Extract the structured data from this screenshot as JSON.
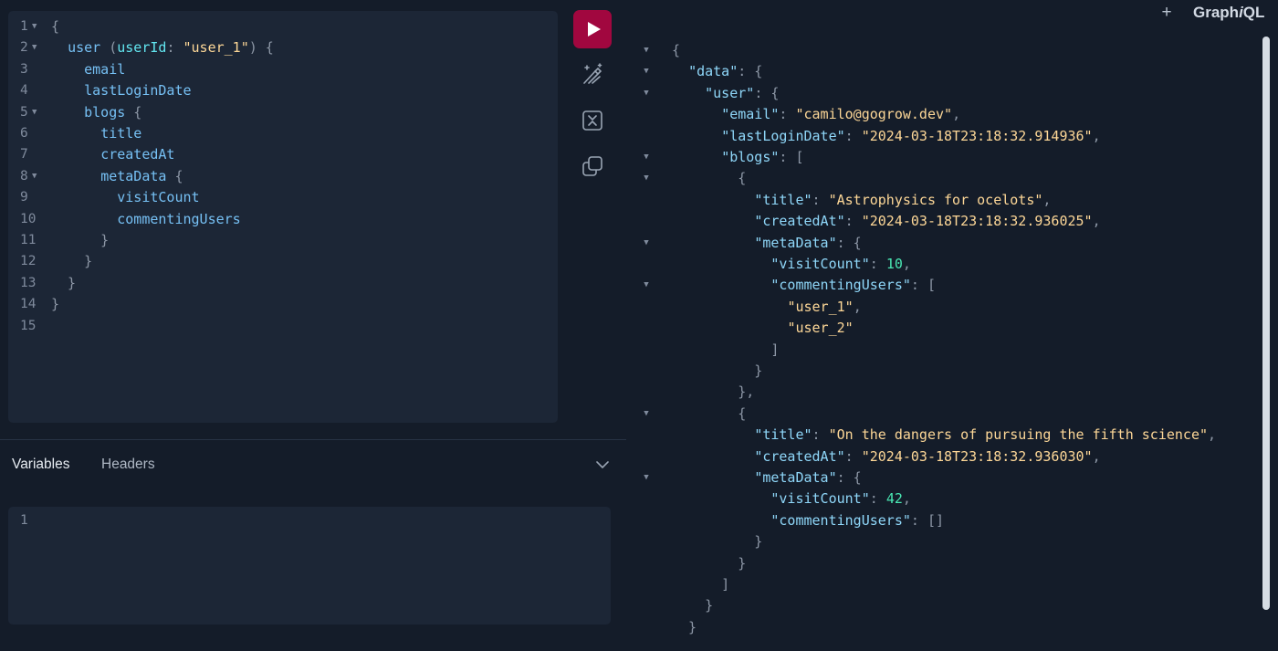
{
  "app": {
    "add_tab_label": "+",
    "brand_prefix": "Graph",
    "brand_i": "i",
    "brand_suffix": "QL"
  },
  "colors": {
    "background": "#141c29",
    "editor_background": "#1c2636",
    "run_button": "#a1073f",
    "field": "#76c0f4",
    "argument": "#62e5ef",
    "string": "#fdd797",
    "number": "#49e6b2",
    "punctuation": "#8d97a6"
  },
  "toolbar": {
    "run_icon": "play-icon",
    "prettify_icon": "magic-wand-icon",
    "merge_fragments_icon": "merge-icon",
    "copy_icon": "copy-icon"
  },
  "query_editor": {
    "folded_lines": [
      1,
      2,
      5,
      8
    ],
    "lines": [
      {
        "number": "1",
        "tokens": [
          {
            "t": "{",
            "c": "punct"
          }
        ]
      },
      {
        "number": "2",
        "tokens": [
          {
            "t": "  ",
            "c": "punct"
          },
          {
            "t": "user",
            "c": "field"
          },
          {
            "t": " (",
            "c": "punct"
          },
          {
            "t": "userId",
            "c": "arg"
          },
          {
            "t": ": ",
            "c": "punct"
          },
          {
            "t": "\"user_1\"",
            "c": "str"
          },
          {
            "t": ") {",
            "c": "punct"
          }
        ]
      },
      {
        "number": "3",
        "tokens": [
          {
            "t": "    ",
            "c": "punct"
          },
          {
            "t": "email",
            "c": "field"
          }
        ]
      },
      {
        "number": "4",
        "tokens": [
          {
            "t": "    ",
            "c": "punct"
          },
          {
            "t": "lastLoginDate",
            "c": "field"
          }
        ]
      },
      {
        "number": "5",
        "tokens": [
          {
            "t": "    ",
            "c": "punct"
          },
          {
            "t": "blogs",
            "c": "field"
          },
          {
            "t": " {",
            "c": "punct"
          }
        ]
      },
      {
        "number": "6",
        "tokens": [
          {
            "t": "      ",
            "c": "punct"
          },
          {
            "t": "title",
            "c": "field"
          }
        ]
      },
      {
        "number": "7",
        "tokens": [
          {
            "t": "      ",
            "c": "punct"
          },
          {
            "t": "createdAt",
            "c": "field"
          }
        ]
      },
      {
        "number": "8",
        "tokens": [
          {
            "t": "      ",
            "c": "punct"
          },
          {
            "t": "metaData",
            "c": "field"
          },
          {
            "t": " {",
            "c": "punct"
          }
        ]
      },
      {
        "number": "9",
        "tokens": [
          {
            "t": "        ",
            "c": "punct"
          },
          {
            "t": "visitCount",
            "c": "field"
          }
        ]
      },
      {
        "number": "10",
        "tokens": [
          {
            "t": "        ",
            "c": "punct"
          },
          {
            "t": "commentingUsers",
            "c": "field"
          }
        ]
      },
      {
        "number": "11",
        "tokens": [
          {
            "t": "      }",
            "c": "punct"
          }
        ]
      },
      {
        "number": "12",
        "tokens": [
          {
            "t": "    }",
            "c": "punct"
          }
        ]
      },
      {
        "number": "13",
        "tokens": [
          {
            "t": "  }",
            "c": "punct"
          }
        ]
      },
      {
        "number": "14",
        "tokens": [
          {
            "t": "}",
            "c": "punct"
          }
        ]
      },
      {
        "number": "15",
        "tokens": []
      }
    ]
  },
  "bottom_panel": {
    "tabs": [
      {
        "label": "Variables",
        "active": true
      },
      {
        "label": "Headers",
        "active": false
      }
    ],
    "toggle_icon": "chevron-down-icon",
    "variables_line_number": "1"
  },
  "result": {
    "fold_markers": [
      1,
      2,
      3,
      6,
      7,
      10,
      12,
      18,
      21
    ],
    "lines": [
      {
        "tokens": [
          {
            "t": "{",
            "c": "punct"
          }
        ]
      },
      {
        "tokens": [
          {
            "t": "  ",
            "c": "punct"
          },
          {
            "t": "\"data\"",
            "c": "key"
          },
          {
            "t": ": {",
            "c": "punct"
          }
        ]
      },
      {
        "tokens": [
          {
            "t": "    ",
            "c": "punct"
          },
          {
            "t": "\"user\"",
            "c": "key"
          },
          {
            "t": ": {",
            "c": "punct"
          }
        ]
      },
      {
        "tokens": [
          {
            "t": "      ",
            "c": "punct"
          },
          {
            "t": "\"email\"",
            "c": "key"
          },
          {
            "t": ": ",
            "c": "punct"
          },
          {
            "t": "\"camilo@gogrow.dev\"",
            "c": "str"
          },
          {
            "t": ",",
            "c": "punct"
          }
        ]
      },
      {
        "tokens": [
          {
            "t": "      ",
            "c": "punct"
          },
          {
            "t": "\"lastLoginDate\"",
            "c": "key"
          },
          {
            "t": ": ",
            "c": "punct"
          },
          {
            "t": "\"2024-03-18T23:18:32.914936\"",
            "c": "str"
          },
          {
            "t": ",",
            "c": "punct"
          }
        ]
      },
      {
        "tokens": [
          {
            "t": "      ",
            "c": "punct"
          },
          {
            "t": "\"blogs\"",
            "c": "key"
          },
          {
            "t": ": [",
            "c": "punct"
          }
        ]
      },
      {
        "tokens": [
          {
            "t": "        {",
            "c": "punct"
          }
        ]
      },
      {
        "tokens": [
          {
            "t": "          ",
            "c": "punct"
          },
          {
            "t": "\"title\"",
            "c": "key"
          },
          {
            "t": ": ",
            "c": "punct"
          },
          {
            "t": "\"Astrophysics for ocelots\"",
            "c": "str"
          },
          {
            "t": ",",
            "c": "punct"
          }
        ]
      },
      {
        "tokens": [
          {
            "t": "          ",
            "c": "punct"
          },
          {
            "t": "\"createdAt\"",
            "c": "key"
          },
          {
            "t": ": ",
            "c": "punct"
          },
          {
            "t": "\"2024-03-18T23:18:32.936025\"",
            "c": "str"
          },
          {
            "t": ",",
            "c": "punct"
          }
        ]
      },
      {
        "tokens": [
          {
            "t": "          ",
            "c": "punct"
          },
          {
            "t": "\"metaData\"",
            "c": "key"
          },
          {
            "t": ": {",
            "c": "punct"
          }
        ]
      },
      {
        "tokens": [
          {
            "t": "            ",
            "c": "punct"
          },
          {
            "t": "\"visitCount\"",
            "c": "key"
          },
          {
            "t": ": ",
            "c": "punct"
          },
          {
            "t": "10",
            "c": "num"
          },
          {
            "t": ",",
            "c": "punct"
          }
        ]
      },
      {
        "tokens": [
          {
            "t": "            ",
            "c": "punct"
          },
          {
            "t": "\"commentingUsers\"",
            "c": "key"
          },
          {
            "t": ": [",
            "c": "punct"
          }
        ]
      },
      {
        "tokens": [
          {
            "t": "              ",
            "c": "punct"
          },
          {
            "t": "\"user_1\"",
            "c": "str"
          },
          {
            "t": ",",
            "c": "punct"
          }
        ]
      },
      {
        "tokens": [
          {
            "t": "              ",
            "c": "punct"
          },
          {
            "t": "\"user_2\"",
            "c": "str"
          }
        ]
      },
      {
        "tokens": [
          {
            "t": "            ]",
            "c": "punct"
          }
        ]
      },
      {
        "tokens": [
          {
            "t": "          }",
            "c": "punct"
          }
        ]
      },
      {
        "tokens": [
          {
            "t": "        },",
            "c": "punct"
          }
        ]
      },
      {
        "tokens": [
          {
            "t": "        {",
            "c": "punct"
          }
        ]
      },
      {
        "tokens": [
          {
            "t": "          ",
            "c": "punct"
          },
          {
            "t": "\"title\"",
            "c": "key"
          },
          {
            "t": ": ",
            "c": "punct"
          },
          {
            "t": "\"On the dangers of pursuing the fifth science\"",
            "c": "str"
          },
          {
            "t": ",",
            "c": "punct"
          }
        ]
      },
      {
        "tokens": [
          {
            "t": "          ",
            "c": "punct"
          },
          {
            "t": "\"createdAt\"",
            "c": "key"
          },
          {
            "t": ": ",
            "c": "punct"
          },
          {
            "t": "\"2024-03-18T23:18:32.936030\"",
            "c": "str"
          },
          {
            "t": ",",
            "c": "punct"
          }
        ]
      },
      {
        "tokens": [
          {
            "t": "          ",
            "c": "punct"
          },
          {
            "t": "\"metaData\"",
            "c": "key"
          },
          {
            "t": ": {",
            "c": "punct"
          }
        ]
      },
      {
        "tokens": [
          {
            "t": "            ",
            "c": "punct"
          },
          {
            "t": "\"visitCount\"",
            "c": "key"
          },
          {
            "t": ": ",
            "c": "punct"
          },
          {
            "t": "42",
            "c": "num"
          },
          {
            "t": ",",
            "c": "punct"
          }
        ]
      },
      {
        "tokens": [
          {
            "t": "            ",
            "c": "punct"
          },
          {
            "t": "\"commentingUsers\"",
            "c": "key"
          },
          {
            "t": ": []",
            "c": "punct"
          }
        ]
      },
      {
        "tokens": [
          {
            "t": "          }",
            "c": "punct"
          }
        ]
      },
      {
        "tokens": [
          {
            "t": "        }",
            "c": "punct"
          }
        ]
      },
      {
        "tokens": [
          {
            "t": "      ]",
            "c": "punct"
          }
        ]
      },
      {
        "tokens": [
          {
            "t": "    }",
            "c": "punct"
          }
        ]
      },
      {
        "tokens": [
          {
            "t": "  }",
            "c": "punct"
          }
        ]
      }
    ]
  }
}
